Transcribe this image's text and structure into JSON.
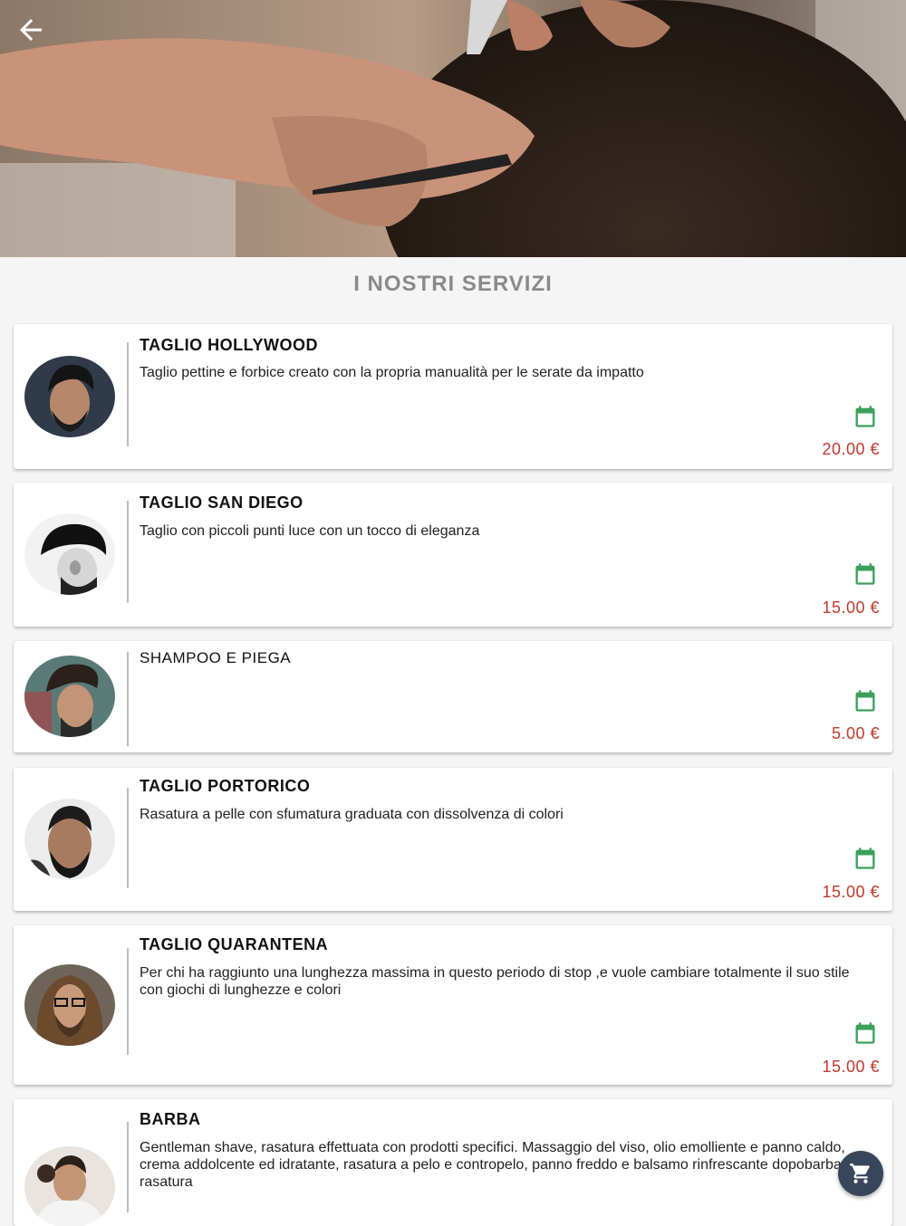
{
  "header": {
    "back_icon": "arrow-left-icon",
    "hero_image": "barber-cutting-hair-photo"
  },
  "section": {
    "title": "I NOSTRI SERVIZI"
  },
  "services": [
    {
      "title": "TAGLIO HOLLYWOOD",
      "description": "Taglio pettine e forbice creato con la propria manualità per le serate da impatto",
      "price": "20.00 €",
      "icon": "calendar-icon"
    },
    {
      "title": "TAGLIO SAN DIEGO",
      "description": "Taglio con piccoli punti luce con un tocco di eleganza",
      "price": "15.00 €",
      "icon": "calendar-icon"
    },
    {
      "title": "SHAMPOO E PIEGA",
      "description": "",
      "price": "5.00 €",
      "icon": "calendar-icon"
    },
    {
      "title": "TAGLIO PORTORICO",
      "description": "Rasatura a pelle con sfumatura graduata con dissolvenza di colori",
      "price": "15.00 €",
      "icon": "calendar-icon"
    },
    {
      "title": "TAGLIO QUARANTENA",
      "description": "Per chi ha raggiunto una lunghezza massima in questo periodo di stop ,e vuole cambiare totalmente il suo stile con giochi di lunghezze e colori",
      "price": "15.00 €",
      "icon": "calendar-icon"
    },
    {
      "title": "BARBA",
      "description": "Gentleman shave, rasatura effettuata con prodotti specifici. Massaggio del viso, olio emolliente e panno caldo, crema addolcente ed idratante, rasatura a pelo e contropelo, panno freddo e balsamo rinfrescante dopobarba post rasatura",
      "price": "",
      "icon": "calendar-icon"
    }
  ],
  "fab": {
    "icon": "shopping-cart-icon"
  },
  "colors": {
    "price": "#c0392b",
    "calendar": "#3aa05a",
    "fab": "#37465a",
    "section_title": "#8a8a8a"
  }
}
